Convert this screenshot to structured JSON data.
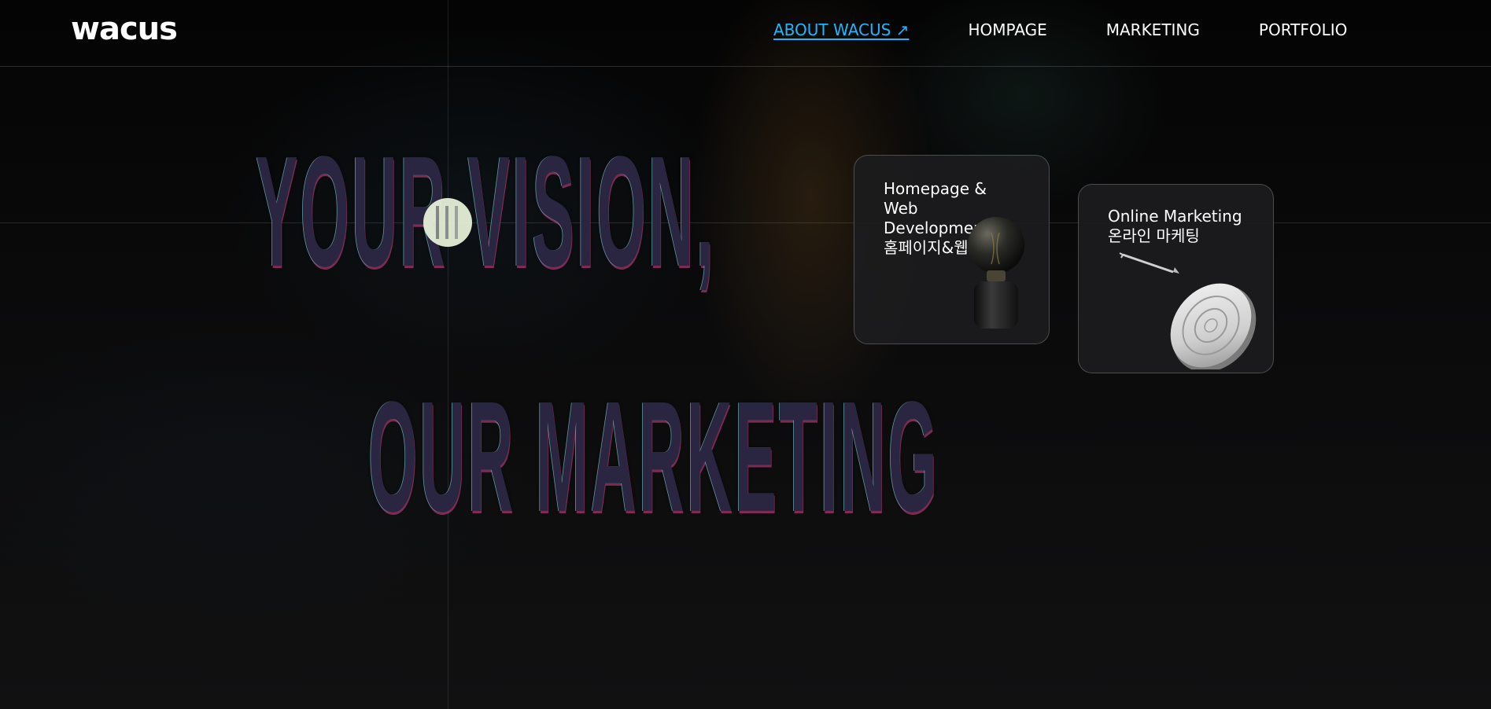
{
  "header": {
    "logo": "wacus",
    "nav": [
      {
        "label": "ABOUT WACUS ↗",
        "active": true
      },
      {
        "label": "HOMPAGE",
        "active": false
      },
      {
        "label": "MARKETING",
        "active": false
      },
      {
        "label": "PORTFOLIO",
        "active": false
      }
    ]
  },
  "hero": {
    "line1": "YOUR VISION,",
    "line2": "OUR MARKETING"
  },
  "cards": [
    {
      "title_lines": [
        "Homepage &",
        "Web",
        "Development",
        "홈페이지&웹"
      ],
      "icon": "light-bulb-icon"
    },
    {
      "title_lines": [
        "Online Marketing",
        "온라인 마케팅"
      ],
      "icon": "target-dart-icon"
    }
  ],
  "colors": {
    "accent": "#1fb6ff",
    "background": "#0b0b0c",
    "card_bg": "#1c1c1e",
    "hero_text": "#2a2540"
  }
}
